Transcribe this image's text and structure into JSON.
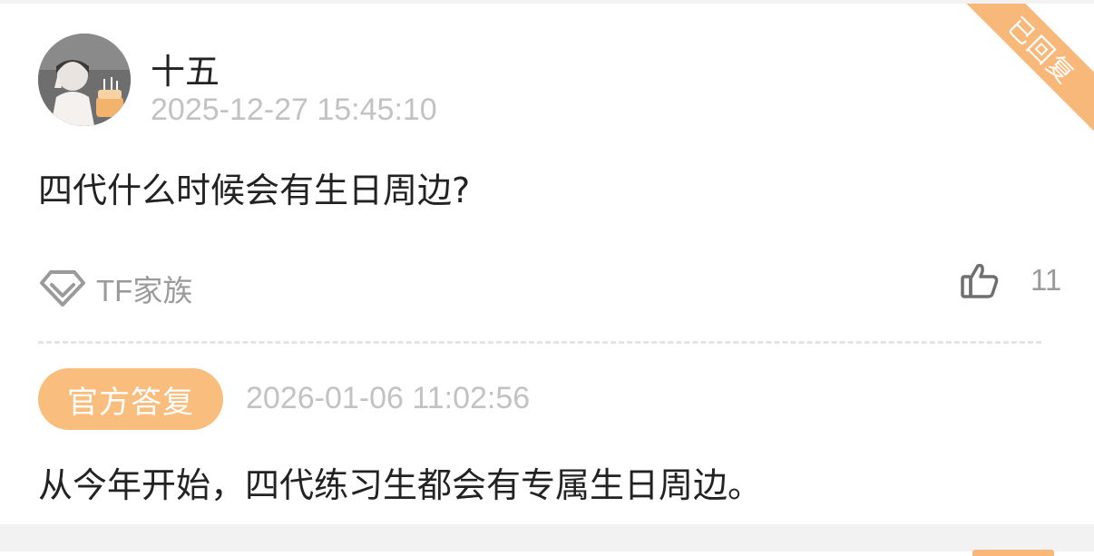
{
  "post": {
    "status_ribbon": "已回复",
    "author": {
      "name": "十五",
      "avatar": "avatar-photo"
    },
    "timestamp": "2025-12-27 15:45:10",
    "question": "四代什么时候会有生日周边?",
    "group": {
      "icon": "diamond-icon",
      "label": "TF家族"
    },
    "likes": {
      "icon": "thumbs-up-icon",
      "count": "11"
    }
  },
  "reply": {
    "badge": "官方答复",
    "timestamp": "2026-01-06 11:02:56",
    "text": "从今年开始，四代练习生都会有专属生日周边。"
  },
  "colors": {
    "accent": "#f9bd7e",
    "ribbon": "#f7b87a",
    "text": "#222222",
    "muted": "#c2c2c2",
    "icon": "#9a9a9a",
    "page_bg": "#f2f2f2"
  }
}
